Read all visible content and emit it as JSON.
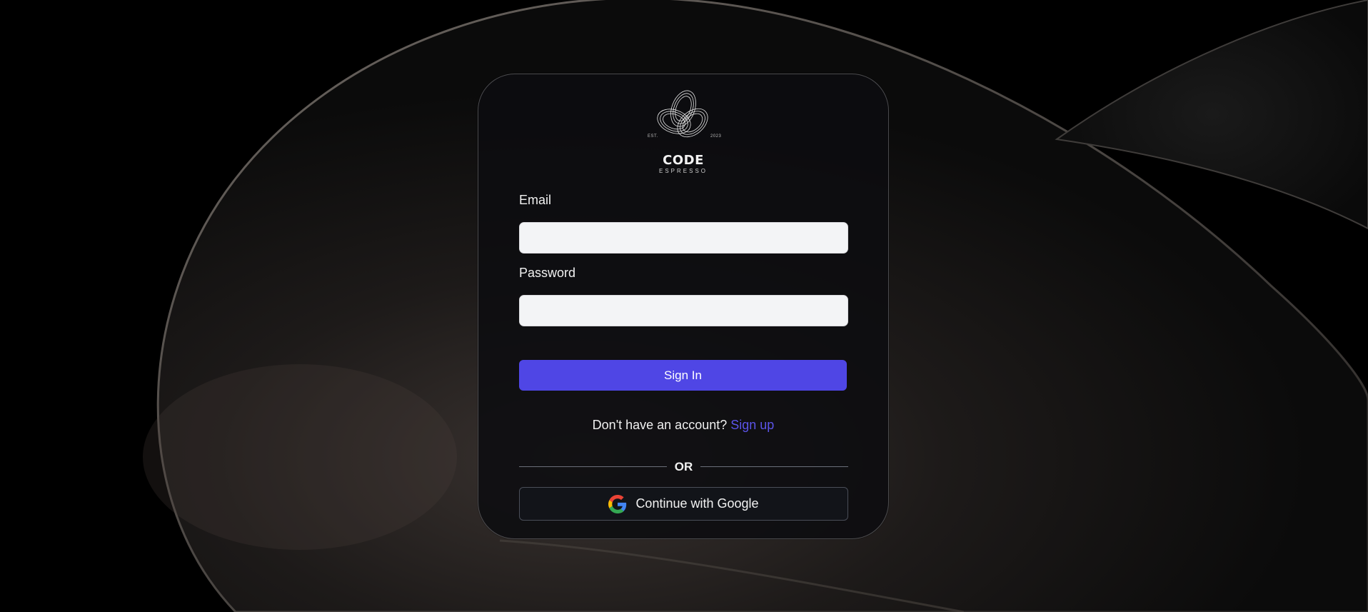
{
  "logo": {
    "est": "EST.",
    "year": "2023",
    "name": "CODE",
    "tagline": "ESPRESSO"
  },
  "form": {
    "email_label": "Email",
    "email_value": "",
    "password_label": "Password",
    "password_value": "",
    "signin_label": "Sign In"
  },
  "signup": {
    "prompt": "Don't have an account?",
    "link": "Sign up"
  },
  "divider": {
    "text": "OR"
  },
  "google": {
    "label": "Continue with Google"
  },
  "colors": {
    "accent": "#4f46e5",
    "link": "#5b54e8",
    "card_bg": "#0c0d10",
    "input_bg": "#f3f4f6"
  }
}
